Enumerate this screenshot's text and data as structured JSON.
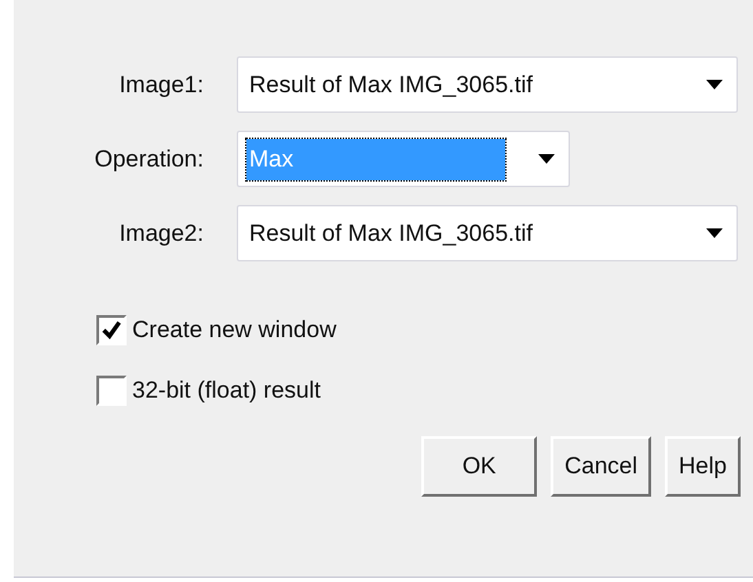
{
  "fields": [
    {
      "label": "Image1:",
      "value": "Result of Max IMG_3065.tif",
      "wide": true,
      "focused": false
    },
    {
      "label": "Operation:",
      "value": "Max",
      "wide": false,
      "focused": true
    },
    {
      "label": "Image2:",
      "value": "Result of Max IMG_3065.tif",
      "wide": true,
      "focused": false
    }
  ],
  "checkboxes": [
    {
      "label": "Create new window",
      "checked": true
    },
    {
      "label": "32-bit (float) result",
      "checked": false
    }
  ],
  "buttons": [
    "OK",
    "Cancel",
    "Help"
  ]
}
